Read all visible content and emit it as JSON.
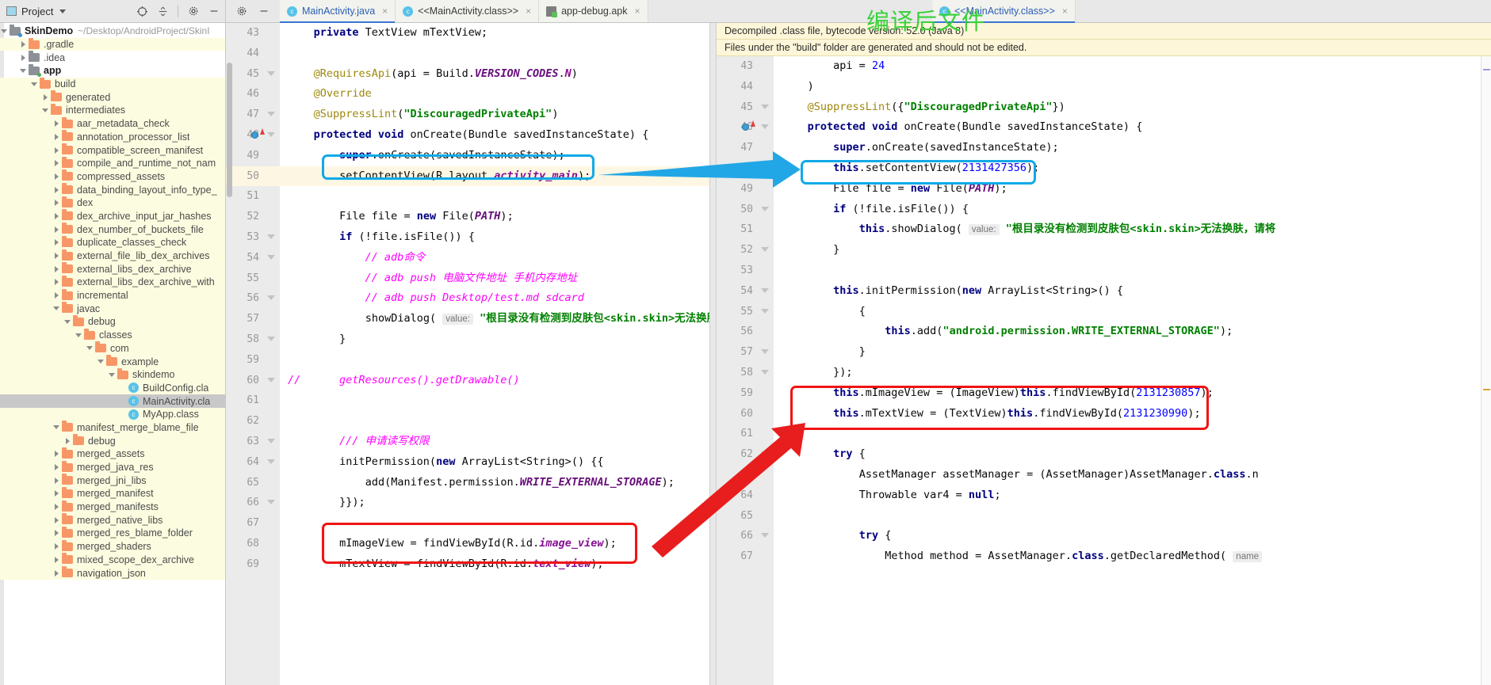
{
  "project_panel": {
    "title": "Project",
    "icons": [
      "target-icon",
      "collapse-all-icon",
      "gear-icon",
      "minimize-icon"
    ],
    "root": {
      "label": "SkinDemo",
      "path": "~/Desktop/AndroidProject/SkinI"
    },
    "items": [
      {
        "label": ".gradle",
        "depth": 1,
        "arrow": "closed",
        "icon": "folder-orange",
        "bg": "build"
      },
      {
        "label": ".idea",
        "depth": 1,
        "arrow": "closed",
        "icon": "folder-grey",
        "bg": "none"
      },
      {
        "label": "app",
        "depth": 1,
        "arrow": "open",
        "icon": "folder-grey-green",
        "bg": "none",
        "bold": true
      },
      {
        "label": "build",
        "depth": 2,
        "arrow": "open",
        "icon": "folder-orange",
        "bg": "build"
      },
      {
        "label": "generated",
        "depth": 3,
        "arrow": "closed",
        "icon": "folder-orange",
        "bg": "build"
      },
      {
        "label": "intermediates",
        "depth": 3,
        "arrow": "open",
        "icon": "folder-orange",
        "bg": "build"
      },
      {
        "label": "aar_metadata_check",
        "depth": 4,
        "arrow": "closed",
        "icon": "folder-orange",
        "bg": "build"
      },
      {
        "label": "annotation_processor_list",
        "depth": 4,
        "arrow": "closed",
        "icon": "folder-orange",
        "bg": "build"
      },
      {
        "label": "compatible_screen_manifest",
        "depth": 4,
        "arrow": "closed",
        "icon": "folder-orange",
        "bg": "build"
      },
      {
        "label": "compile_and_runtime_not_nam",
        "depth": 4,
        "arrow": "closed",
        "icon": "folder-orange",
        "bg": "build"
      },
      {
        "label": "compressed_assets",
        "depth": 4,
        "arrow": "closed",
        "icon": "folder-orange",
        "bg": "build"
      },
      {
        "label": "data_binding_layout_info_type_",
        "depth": 4,
        "arrow": "closed",
        "icon": "folder-orange",
        "bg": "build"
      },
      {
        "label": "dex",
        "depth": 4,
        "arrow": "closed",
        "icon": "folder-orange",
        "bg": "build"
      },
      {
        "label": "dex_archive_input_jar_hashes",
        "depth": 4,
        "arrow": "closed",
        "icon": "folder-orange",
        "bg": "build"
      },
      {
        "label": "dex_number_of_buckets_file",
        "depth": 4,
        "arrow": "closed",
        "icon": "folder-orange",
        "bg": "build"
      },
      {
        "label": "duplicate_classes_check",
        "depth": 4,
        "arrow": "closed",
        "icon": "folder-orange",
        "bg": "build"
      },
      {
        "label": "external_file_lib_dex_archives",
        "depth": 4,
        "arrow": "closed",
        "icon": "folder-orange",
        "bg": "build"
      },
      {
        "label": "external_libs_dex_archive",
        "depth": 4,
        "arrow": "closed",
        "icon": "folder-orange",
        "bg": "build"
      },
      {
        "label": "external_libs_dex_archive_with",
        "depth": 4,
        "arrow": "closed",
        "icon": "folder-orange",
        "bg": "build"
      },
      {
        "label": "incremental",
        "depth": 4,
        "arrow": "closed",
        "icon": "folder-orange",
        "bg": "build"
      },
      {
        "label": "javac",
        "depth": 4,
        "arrow": "open",
        "icon": "folder-orange",
        "bg": "build"
      },
      {
        "label": "debug",
        "depth": 5,
        "arrow": "open",
        "icon": "folder-orange",
        "bg": "build"
      },
      {
        "label": "classes",
        "depth": 6,
        "arrow": "open",
        "icon": "folder-orange",
        "bg": "build"
      },
      {
        "label": "com",
        "depth": 7,
        "arrow": "open",
        "icon": "folder-orange",
        "bg": "build"
      },
      {
        "label": "example",
        "depth": 8,
        "arrow": "open",
        "icon": "folder-orange",
        "bg": "build"
      },
      {
        "label": "skindemo",
        "depth": 9,
        "arrow": "open",
        "icon": "folder-orange",
        "bg": "build"
      },
      {
        "label": "BuildConfig.cla",
        "depth": 10,
        "arrow": "none",
        "icon": "class-file",
        "bg": "build"
      },
      {
        "label": "MainActivity.cla",
        "depth": 10,
        "arrow": "none",
        "icon": "class-file",
        "bg": "selected"
      },
      {
        "label": "MyApp.class",
        "depth": 10,
        "arrow": "none",
        "icon": "class-file",
        "bg": "build"
      },
      {
        "label": "manifest_merge_blame_file",
        "depth": 4,
        "arrow": "open",
        "icon": "folder-orange",
        "bg": "build"
      },
      {
        "label": "debug",
        "depth": 5,
        "arrow": "closed",
        "icon": "folder-orange",
        "bg": "build"
      },
      {
        "label": "merged_assets",
        "depth": 4,
        "arrow": "closed",
        "icon": "folder-orange",
        "bg": "build"
      },
      {
        "label": "merged_java_res",
        "depth": 4,
        "arrow": "closed",
        "icon": "folder-orange",
        "bg": "build"
      },
      {
        "label": "merged_jni_libs",
        "depth": 4,
        "arrow": "closed",
        "icon": "folder-orange",
        "bg": "build"
      },
      {
        "label": "merged_manifest",
        "depth": 4,
        "arrow": "closed",
        "icon": "folder-orange",
        "bg": "build"
      },
      {
        "label": "merged_manifests",
        "depth": 4,
        "arrow": "closed",
        "icon": "folder-orange",
        "bg": "build"
      },
      {
        "label": "merged_native_libs",
        "depth": 4,
        "arrow": "closed",
        "icon": "folder-orange",
        "bg": "build"
      },
      {
        "label": "merged_res_blame_folder",
        "depth": 4,
        "arrow": "closed",
        "icon": "folder-orange",
        "bg": "build"
      },
      {
        "label": "merged_shaders",
        "depth": 4,
        "arrow": "closed",
        "icon": "folder-orange",
        "bg": "build"
      },
      {
        "label": "mixed_scope_dex_archive",
        "depth": 4,
        "arrow": "closed",
        "icon": "folder-orange",
        "bg": "build"
      },
      {
        "label": "navigation_json",
        "depth": 4,
        "arrow": "closed",
        "icon": "folder-orange",
        "bg": "build"
      }
    ]
  },
  "tabs_left": [
    {
      "label": "MainActivity.java",
      "icon": "class-icon",
      "active": true,
      "close": "×"
    },
    {
      "label": "<<MainActivity.class>>",
      "icon": "class-icon",
      "active": false,
      "close": "×"
    },
    {
      "label": "app-debug.apk",
      "icon": "apk-icon",
      "active": false,
      "close": "×"
    }
  ],
  "tabs_right": [
    {
      "label": "<<MainActivity.class>>",
      "icon": "class-icon",
      "active": true,
      "close": "×"
    }
  ],
  "annotation": {
    "text": "编译后文件",
    "color": "#3ad13a"
  },
  "right_banners": [
    "Decompiled .class file, bytecode version: 52.0 (Java 8)",
    "Files under the \"build\" folder are generated and should not be edited."
  ],
  "left_editor": {
    "first_line": 43,
    "lines": [
      {
        "n": 43,
        "text": "    private TextView mTextView;"
      },
      {
        "n": 44,
        "text": ""
      },
      {
        "n": 45,
        "text": "    @RequiresApi(api = Build.VERSION_CODES.N)"
      },
      {
        "n": 46,
        "text": "    @Override"
      },
      {
        "n": 47,
        "text": "    @SuppressLint(\"DiscouragedPrivateApi\")"
      },
      {
        "n": 48,
        "text": "    protected void onCreate(Bundle savedInstanceState) {"
      },
      {
        "n": 49,
        "text": "        super.onCreate(savedInstanceState);"
      },
      {
        "n": 50,
        "text": "        setContentView(R.layout.activity_main);"
      },
      {
        "n": 51,
        "text": ""
      },
      {
        "n": 52,
        "text": "        File file = new File(PATH);"
      },
      {
        "n": 53,
        "text": "        if (!file.isFile()) {"
      },
      {
        "n": 54,
        "text": "            // adb命令"
      },
      {
        "n": 55,
        "text": "            // adb push 电脑文件地址 手机内存地址"
      },
      {
        "n": 56,
        "text": "            // adb push Desktop/test.md sdcard"
      },
      {
        "n": 57,
        "text": "            showDialog( value: \"根目录没有检测到皮肤包<skin.skin>无法换肤"
      },
      {
        "n": 58,
        "text": "        }"
      },
      {
        "n": 59,
        "text": ""
      },
      {
        "n": 60,
        "text": "//      getResources().getDrawable()"
      },
      {
        "n": 61,
        "text": ""
      },
      {
        "n": 62,
        "text": ""
      },
      {
        "n": 63,
        "text": "        /// 申请读写权限"
      },
      {
        "n": 64,
        "text": "        initPermission(new ArrayList<String>() {{"
      },
      {
        "n": 65,
        "text": "            add(Manifest.permission.WRITE_EXTERNAL_STORAGE);"
      },
      {
        "n": 66,
        "text": "        }});"
      },
      {
        "n": 67,
        "text": ""
      },
      {
        "n": 68,
        "text": "        mImageView = findViewById(R.id.image_view);"
      },
      {
        "n": 69,
        "text": "        mTextView = findViewById(R.id.text_view);"
      }
    ]
  },
  "right_editor": {
    "first_line": 43,
    "lines": [
      {
        "n": 43,
        "text": "        api = 24"
      },
      {
        "n": 44,
        "text": "    )"
      },
      {
        "n": 45,
        "text": "    @SuppressLint({\"DiscouragedPrivateApi\"})"
      },
      {
        "n": 46,
        "text": "    protected void onCreate(Bundle savedInstanceState) {"
      },
      {
        "n": 47,
        "text": "        super.onCreate(savedInstanceState);"
      },
      {
        "n": 48,
        "text": "        this.setContentView(2131427356);"
      },
      {
        "n": 49,
        "text": "        File file = new File(PATH);"
      },
      {
        "n": 50,
        "text": "        if (!file.isFile()) {"
      },
      {
        "n": 51,
        "text": "            this.showDialog( value: \"根目录没有检测到皮肤包<skin.skin>无法换肤，请将"
      },
      {
        "n": 52,
        "text": "        }"
      },
      {
        "n": 53,
        "text": ""
      },
      {
        "n": 54,
        "text": "        this.initPermission(new ArrayList<String>() {"
      },
      {
        "n": 55,
        "text": "            {"
      },
      {
        "n": 56,
        "text": "                this.add(\"android.permission.WRITE_EXTERNAL_STORAGE\");"
      },
      {
        "n": 57,
        "text": "            }"
      },
      {
        "n": 58,
        "text": "        });"
      },
      {
        "n": 59,
        "text": "        this.mImageView = (ImageView)this.findViewById(2131230857);"
      },
      {
        "n": 60,
        "text": "        this.mTextView = (TextView)this.findViewById(2131230990);"
      },
      {
        "n": 61,
        "text": ""
      },
      {
        "n": 62,
        "text": "        try {"
      },
      {
        "n": 63,
        "text": "            AssetManager assetManager = (AssetManager)AssetManager.class.n"
      },
      {
        "n": 64,
        "text": "            Throwable var4 = null;"
      },
      {
        "n": 65,
        "text": ""
      },
      {
        "n": 66,
        "text": "            try {"
      },
      {
        "n": 67,
        "text": "                Method method = AssetManager.class.getDeclaredMethod( name"
      }
    ]
  },
  "highlight_boxes": [
    {
      "name": "left-setcontentview-box",
      "color": "#11a9e8"
    },
    {
      "name": "right-setcontentview-box",
      "color": "#11a9e8"
    },
    {
      "name": "left-findviewbyid-box",
      "color": "#f01414"
    },
    {
      "name": "right-findviewbyid-box",
      "color": "#f01414"
    }
  ],
  "arrows": [
    {
      "name": "blue-arrow",
      "color": "#22a7e6"
    },
    {
      "name": "red-arrow",
      "color": "#e81e1e"
    }
  ]
}
